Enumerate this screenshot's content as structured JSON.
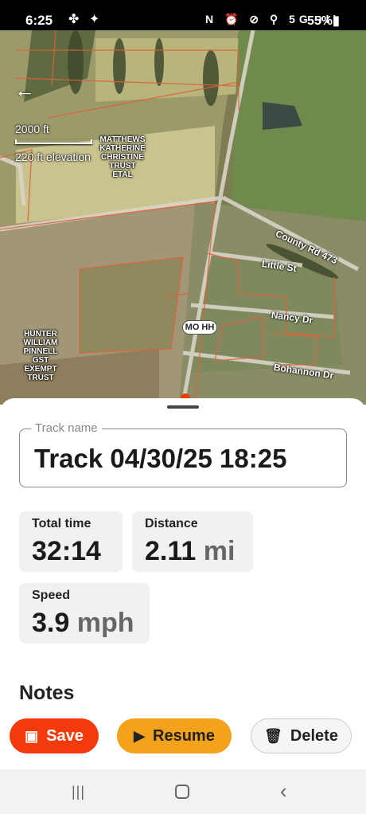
{
  "status_bar": {
    "time": "6:25",
    "left_icons": "✤ ✦",
    "right_icons": "N ⏰ ⊘ ⚲ 5G ıll",
    "battery": "55%▮"
  },
  "map": {
    "back_icon": "arrow-left-icon",
    "scale_text": "2000 ft",
    "elevation_text": "220 ft elevation",
    "parcel_labels": [
      "MATTHEWS\nKATHERINE\nCHRISTINE\nTRUST\nETAL",
      "HUNTER\nWILLIAM\nPINNELL\nGST\nEXEMPT\nTRUST"
    ],
    "road_labels": [
      "County Rd 473",
      "Little St",
      "Nancy Dr",
      "Bohannon Dr"
    ],
    "shield_label": "MO HH"
  },
  "sheet": {
    "track_name_label": "Track name",
    "track_name_value": "Track 04/30/25 18:25",
    "stats": {
      "total_time": {
        "label": "Total time",
        "value": "32:14",
        "unit": ""
      },
      "distance": {
        "label": "Distance",
        "value": "2.11",
        "unit": "mi"
      },
      "speed": {
        "label": "Speed",
        "value": "3.9",
        "unit": "mph"
      }
    },
    "notes_heading": "Notes",
    "buttons": {
      "save": "Save",
      "resume": "Resume",
      "delete": "Delete"
    }
  },
  "colors": {
    "save_button": "#f23a0a",
    "resume_button": "#f4a21c",
    "parcel_lines": "#e0613a",
    "track_line": "#f23a0a"
  }
}
